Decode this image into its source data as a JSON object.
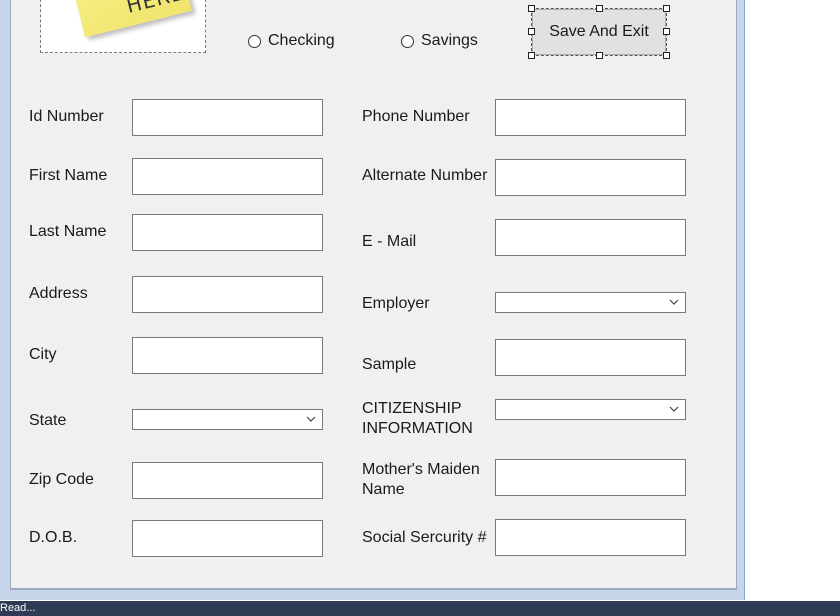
{
  "logo": {
    "text": "HERE"
  },
  "radios": {
    "checking": "Checking",
    "savings": "Savings"
  },
  "buttons": {
    "save_exit": "Save And Exit"
  },
  "left_fields": {
    "id_number": "Id Number",
    "first_name": "First Name",
    "last_name": "Last Name",
    "address": "Address",
    "city": "City",
    "state": "State",
    "zip_code": "Zip Code",
    "dob": "D.O.B."
  },
  "right_fields": {
    "phone_number": "Phone Number",
    "alternate_number": "Alternate Number",
    "email": "E - Mail",
    "employer": "Employer",
    "sample": "Sample",
    "citizenship_1": "CITIZENSHIP",
    "citizenship_2": "INFORMATION",
    "maiden_1": "Mother's Maiden",
    "maiden_2": "Name",
    "ssn": "Social Sercurity #"
  },
  "values": {
    "id_number": "",
    "first_name": "",
    "last_name": "",
    "address": "",
    "city": "",
    "zip_code": "",
    "dob": "",
    "phone_number": "",
    "alternate_number": "",
    "email": "",
    "sample": "",
    "maiden_name": "",
    "ssn": "",
    "state": "",
    "employer": "",
    "citizenship": ""
  },
  "status_bar": {
    "text": "Read..."
  },
  "icons": [
    "chevron-down-icon"
  ]
}
